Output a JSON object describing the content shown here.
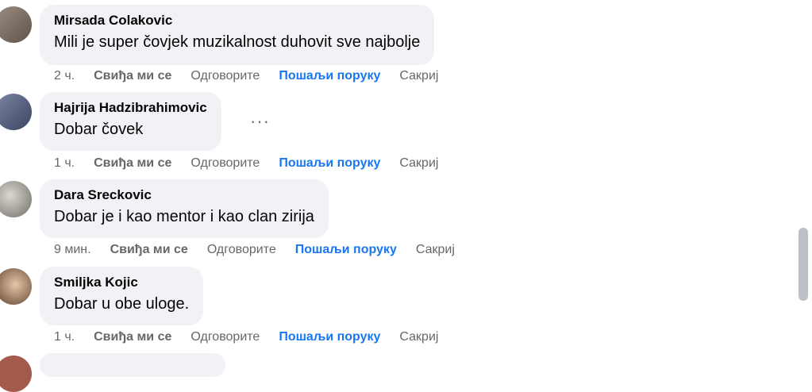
{
  "comments": [
    {
      "author": "Mirsada Colakovic",
      "text": "Mili je super čovjek muzikalnost duhovit sve najbolje",
      "time": "2 ч.",
      "like": "Свиђа ми се",
      "reply": "Одговорите",
      "message": "Пошаљи поруку",
      "hide": "Сакриј"
    },
    {
      "author": "Hajrija Hadzibrahimovic",
      "text": "Dobar čovek",
      "time": "1 ч.",
      "like": "Свиђа ми се",
      "reply": "Одговорите",
      "message": "Пошаљи поруку",
      "hide": "Сакриј",
      "more": "···"
    },
    {
      "author": "Dara Sreckovic",
      "text": "Dobar je i kao mentor i kao clan zirija",
      "time": "9 мин.",
      "like": "Свиђа ми се",
      "reply": "Одговорите",
      "message": "Пошаљи поруку",
      "hide": "Сакриј"
    },
    {
      "author": "Smiljka Kojic",
      "text": "Dobar u obe uloge.",
      "time": "1 ч.",
      "like": "Свиђа ми се",
      "reply": "Одговорите",
      "message": "Пошаљи поруку",
      "hide": "Сакриј"
    }
  ]
}
